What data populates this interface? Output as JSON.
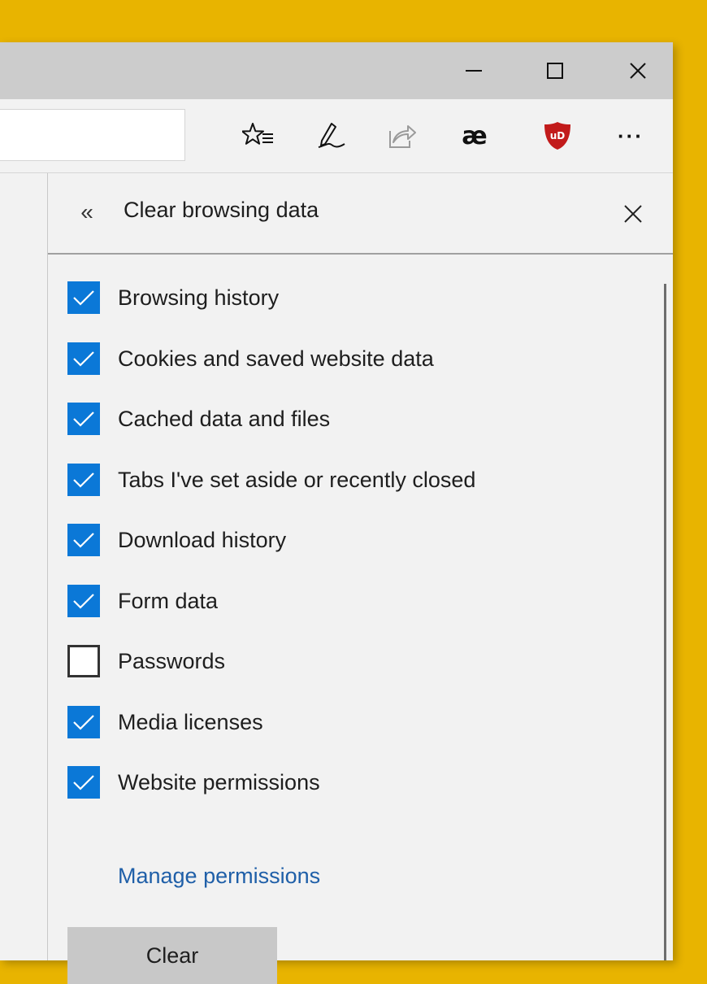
{
  "window_controls": {
    "minimize_icon": "minimize-icon",
    "maximize_icon": "maximize-icon",
    "close_icon": "close-icon"
  },
  "toolbar": {
    "icons": [
      "favorites-star-icon",
      "pen-icon",
      "share-icon",
      "ae-extension-icon",
      "ublock-origin-icon",
      "more-icon"
    ],
    "ae_extension_label": "æ",
    "more_label": "···"
  },
  "panel": {
    "back_glyph": "«",
    "title": "Clear browsing data",
    "options": [
      {
        "label": "Browsing history",
        "checked": true
      },
      {
        "label": "Cookies and saved website data",
        "checked": true
      },
      {
        "label": "Cached data and files",
        "checked": true
      },
      {
        "label": "Tabs I've set aside or recently closed",
        "checked": true
      },
      {
        "label": "Download history",
        "checked": true
      },
      {
        "label": "Form data",
        "checked": true
      },
      {
        "label": "Passwords",
        "checked": false
      },
      {
        "label": "Media licenses",
        "checked": true
      },
      {
        "label": "Website permissions",
        "checked": true
      }
    ],
    "manage_link": "Manage permissions",
    "clear_button": "Clear"
  },
  "colors": {
    "desktop": "#e8b400",
    "accent": "#0b78d7",
    "link": "#1f5fa8",
    "ublock_red": "#c21b1b"
  }
}
